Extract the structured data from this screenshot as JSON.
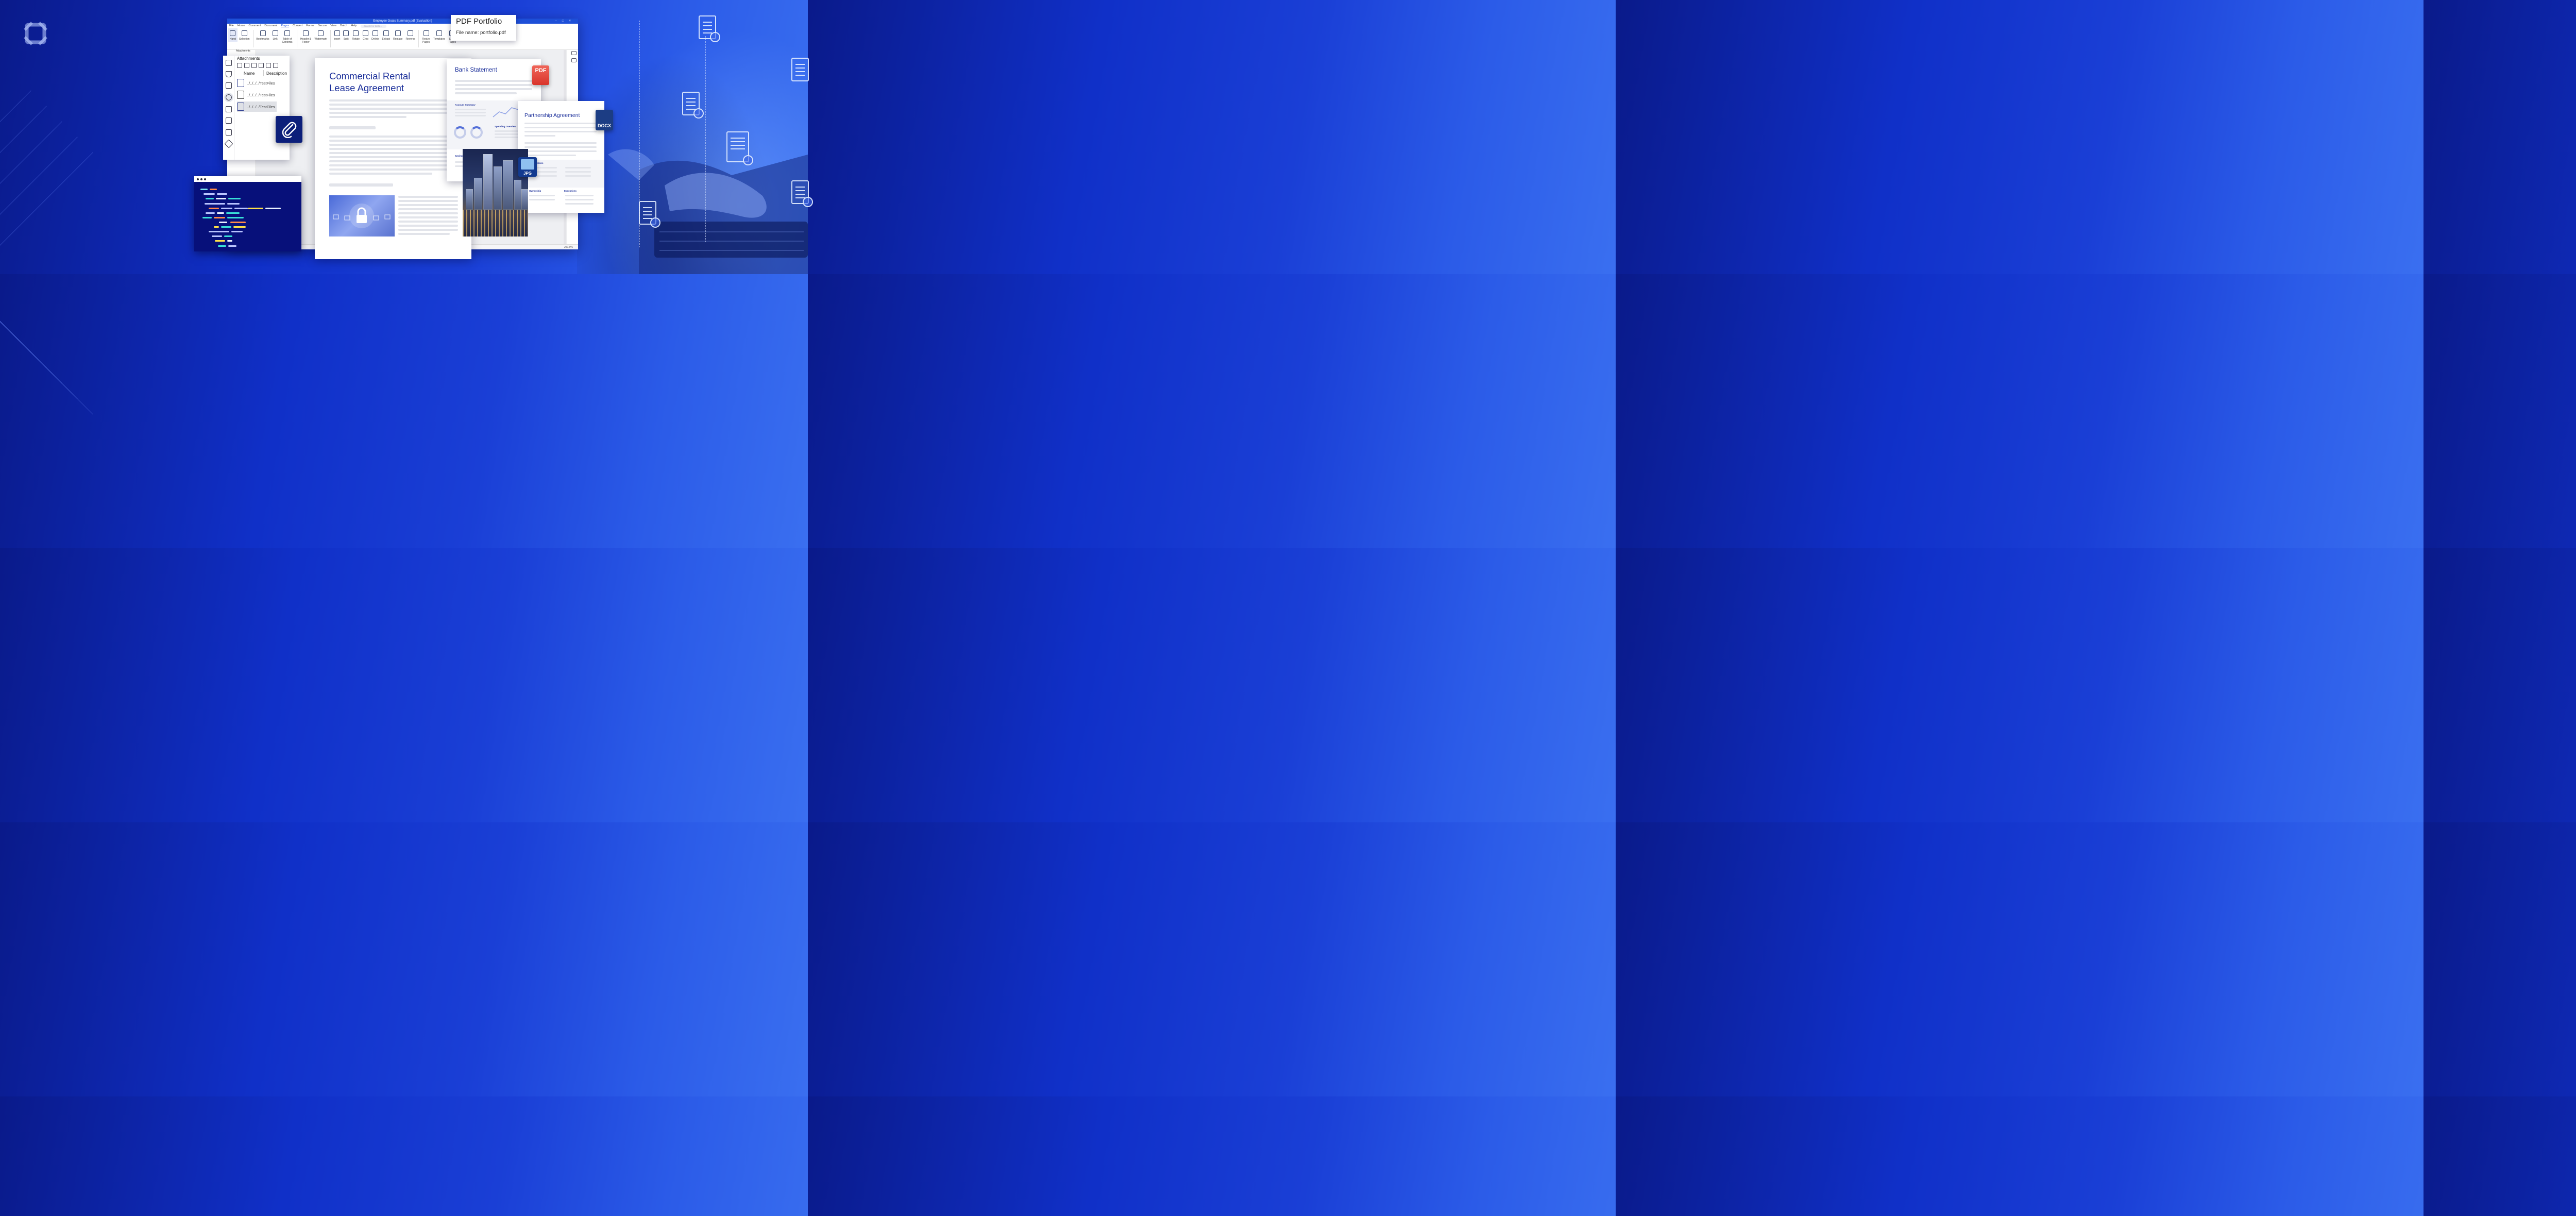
{
  "colors": {
    "brand_blue": "#1d4fd8",
    "doc_title_blue": "#1b2f9a",
    "pdf_badge": "#e0453a",
    "docx_badge": "#1c3d84",
    "jpg_badge": "#123a8f",
    "clip_tile": "#0c1f7a"
  },
  "window": {
    "title": "Employee Goals Summary.pdf (Evaluation)",
    "menu": [
      "File",
      "Home",
      "Comment",
      "Document",
      "Pages",
      "Convert",
      "Forms",
      "Secure",
      "View",
      "Batch",
      "Help"
    ],
    "active_menu": "Pages",
    "search_placeholder": "Search for tools...",
    "ribbon": [
      {
        "label": "Hand",
        "icon": "hand-icon"
      },
      {
        "label": "Selection",
        "icon": "text-select-icon"
      },
      {
        "label": "Bookmarks",
        "icon": "bookmark-icon"
      },
      {
        "label": "Link",
        "icon": "link-icon"
      },
      {
        "label": "Table of Contents",
        "icon": "list-icon"
      },
      {
        "label": "Header & Footer",
        "icon": "header-footer-icon"
      },
      {
        "label": "Watermark",
        "icon": "watermark-icon"
      },
      {
        "label": "Insert",
        "icon": "insert-page-icon"
      },
      {
        "label": "Split",
        "icon": "split-icon"
      },
      {
        "label": "Rotate",
        "icon": "rotate-icon"
      },
      {
        "label": "Crop",
        "icon": "crop-icon"
      },
      {
        "label": "Delete",
        "icon": "trash-icon"
      },
      {
        "label": "Extract",
        "icon": "extract-icon"
      },
      {
        "label": "Replace",
        "icon": "replace-icon"
      },
      {
        "label": "Reverse",
        "icon": "reverse-icon"
      },
      {
        "label": "Resize Pages",
        "icon": "resize-icon"
      },
      {
        "label": "Templates",
        "icon": "templates-icon"
      },
      {
        "label": "Label Pages",
        "icon": "label-icon"
      }
    ],
    "sidebar_header": "Attachments",
    "zoom": "251.9%"
  },
  "attachments": {
    "title": "Attachments",
    "col_name": "Name",
    "col_description": "Description",
    "rows": [
      {
        "name": "../../../../TestFiles",
        "icon": "email-file-icon"
      },
      {
        "name": "../../../../TestFiles",
        "icon": "image-file-icon"
      },
      {
        "name": "../../../../TestFiles",
        "icon": "word-file-icon"
      }
    ]
  },
  "portfolio": {
    "title": "PDF Portfolio",
    "file_name": "File name: portfolio.pdf"
  },
  "main_doc": {
    "title": "Commercial Rental\nLease Agreement"
  },
  "bank": {
    "title": "Bank Statement",
    "badge": "PDF",
    "account_summary": "Account Summary",
    "spending_overview": "Spending Overview",
    "savings": "Savings"
  },
  "partnership": {
    "title": "Partnership Agreement",
    "badge": "DOCX",
    "conditions": "Conditions",
    "ownership": "Ownership",
    "exceptions": "Exceptions"
  },
  "photo": {
    "badge": "JPG"
  }
}
